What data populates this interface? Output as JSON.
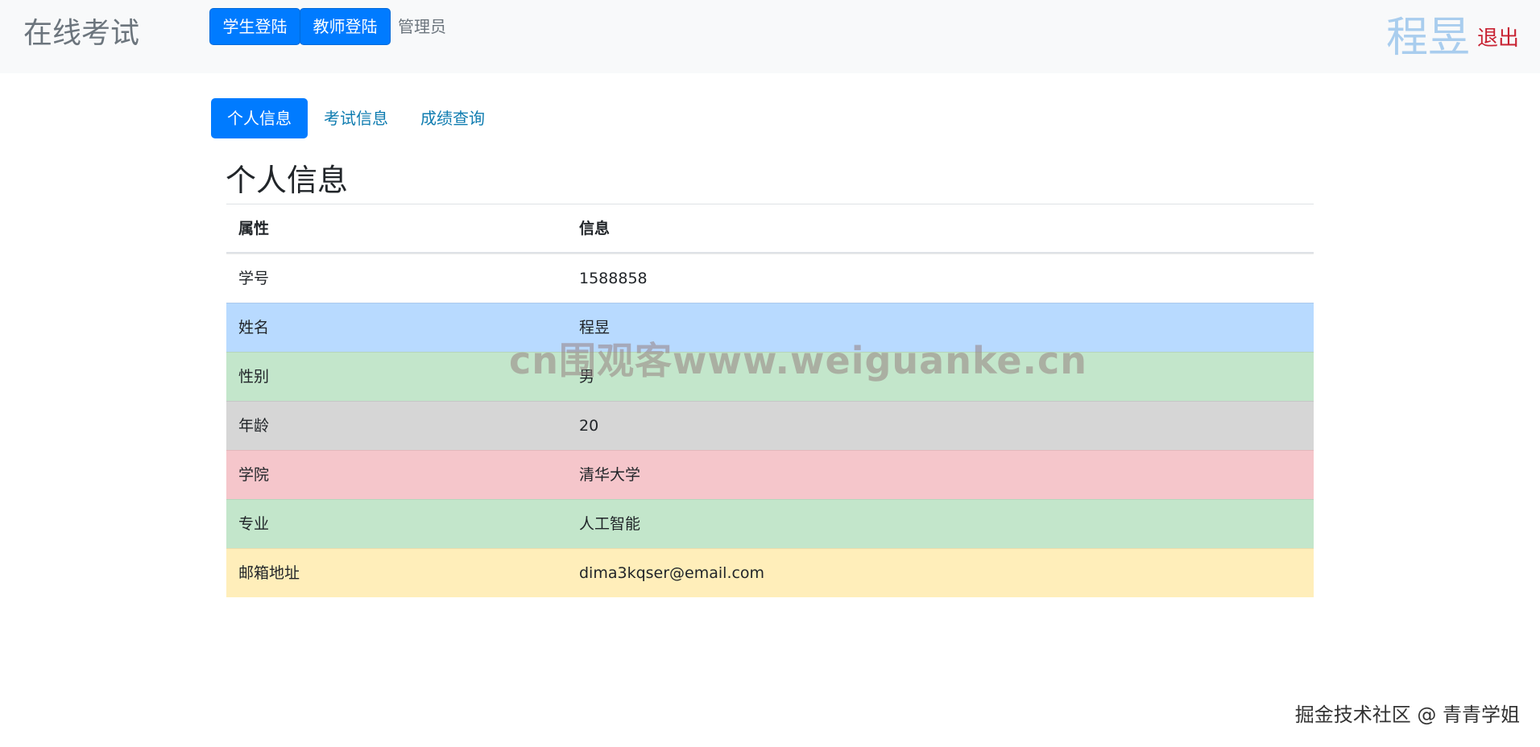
{
  "navbar": {
    "brand": "在线考试",
    "student_login": "学生登陆",
    "teacher_login": "教师登陆",
    "admin": "管理员",
    "username": "程昱",
    "logout": "退出"
  },
  "tabs": [
    {
      "label": "个人信息",
      "active": true
    },
    {
      "label": "考试信息",
      "active": false
    },
    {
      "label": "成绩查询",
      "active": false
    }
  ],
  "page": {
    "title": "个人信息"
  },
  "table": {
    "headers": [
      "属性",
      "信息"
    ],
    "rows": [
      {
        "attr": "学号",
        "value": "1588858",
        "bg": "#ffffff"
      },
      {
        "attr": "姓名",
        "value": "程昱",
        "bg": "#b8daff"
      },
      {
        "attr": "性别",
        "value": "男",
        "bg": "#c3e6cb"
      },
      {
        "attr": "年龄",
        "value": "20",
        "bg": "#d6d6d6"
      },
      {
        "attr": "学院",
        "value": "清华大学",
        "bg": "#f5c6cb"
      },
      {
        "attr": "专业",
        "value": "人工智能",
        "bg": "#c3e6cb"
      },
      {
        "attr": "邮箱地址",
        "value": "dima3kqser@email.com",
        "bg": "#ffeeba"
      }
    ]
  },
  "watermark": "cn围观客www.weiguanke.cn",
  "footer": {
    "credit": "掘金技术社区 @ 青青学姐"
  },
  "colors": {
    "primary": "#007bff",
    "navbar_bg": "#f8f9fa",
    "logout": "#c82333",
    "username": "#a9cdee"
  }
}
